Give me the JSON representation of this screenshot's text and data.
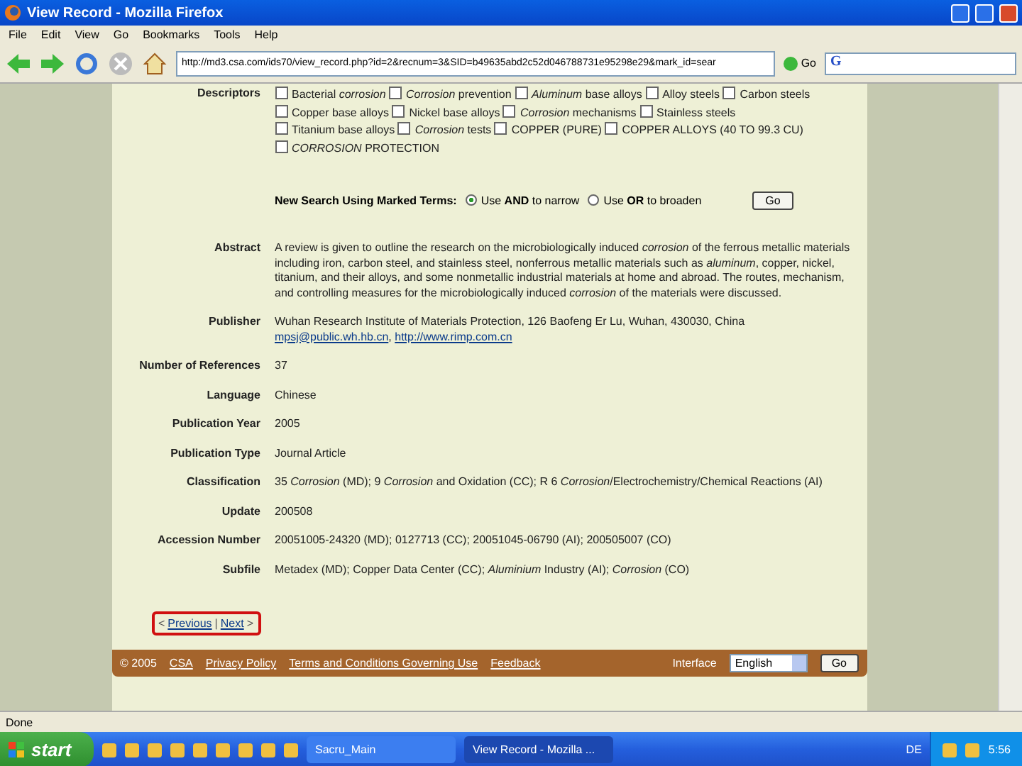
{
  "window": {
    "title": "View Record - Mozilla Firefox"
  },
  "menu": [
    "File",
    "Edit",
    "View",
    "Go",
    "Bookmarks",
    "Tools",
    "Help"
  ],
  "toolbar": {
    "url": "http://md3.csa.com/ids70/view_record.php?id=2&recnum=3&SID=b49635abd2c52d046788731e95298e29&mark_id=sear",
    "go": "Go",
    "search_logo": "G"
  },
  "record": {
    "descriptors": [
      {
        "text": "Bacterial *corrosion*",
        "checked": false
      },
      {
        "text": "*Corrosion* prevention",
        "checked": false
      },
      {
        "text": "*Aluminum* base alloys",
        "checked": false
      },
      {
        "text": "Alloy steels",
        "checked": false
      },
      {
        "text": "Carbon steels",
        "checked": false
      },
      {
        "text": "Copper base alloys",
        "checked": false
      },
      {
        "text": "Nickel base alloys",
        "checked": false
      },
      {
        "text": "*Corrosion* mechanisms",
        "checked": false
      },
      {
        "text": "Stainless steels",
        "checked": false
      },
      {
        "text": "Titanium base alloys",
        "checked": false
      },
      {
        "text": "*Corrosion* tests",
        "checked": false
      },
      {
        "text": "COPPER (PURE)",
        "checked": false
      },
      {
        "text": "COPPER ALLOYS (40 TO 99.3 CU)",
        "checked": false
      },
      {
        "text": "*CORROSION* PROTECTION",
        "checked": false
      }
    ],
    "descriptors_label": "Descriptors",
    "search": {
      "label": "New Search Using Marked Terms:",
      "options": [
        {
          "text": "Use **AND** to narrow",
          "selected": true
        },
        {
          "text": "Use **OR** to broaden",
          "selected": false
        }
      ],
      "button": "Go"
    },
    "fields": [
      {
        "label": "Abstract",
        "value": "A review is given to outline the research on the microbiologically induced *corrosion* of the ferrous metallic materials including iron, carbon steel, and stainless steel, nonferrous metallic materials such as *aluminum*, copper, nickel, titanium, and their alloys, and some nonmetallic industrial materials at home and abroad. The routes, mechanism, and controlling measures for the microbiologically induced *corrosion* of the materials were discussed."
      },
      {
        "label": "Publisher",
        "value": "Wuhan Research Institute of Materials Protection, 126 Baofeng Er Lu, Wuhan, 430030, China",
        "links": [
          "mpsj@public.wh.hb.cn",
          "http://www.rimp.com.cn"
        ],
        "link_separator": ","
      },
      {
        "label": "Number of References",
        "value": "37"
      },
      {
        "label": "Language",
        "value": "Chinese"
      },
      {
        "label": "Publication Year",
        "value": "2005"
      },
      {
        "label": "Publication Type",
        "value": "Journal Article"
      },
      {
        "label": "Classification",
        "value": "35 *Corrosion* (MD); 9 *Corrosion* and Oxidation (CC); R 6 *Corrosion*/Electrochemistry/Chemical Reactions (AI)"
      },
      {
        "label": "Update",
        "value": "200508"
      },
      {
        "label": "Accession Number",
        "value": "20051005-24320 (MD); 0127713 (CC); 20051045-06790 (AI); 200505007 (CO)"
      },
      {
        "label": "Subfile",
        "value": "Metadex (MD); Copper Data Center (CC); *Aluminium* Industry (AI); *Corrosion* (CO)"
      }
    ],
    "nav": {
      "prev_arrow": "<",
      "previous": "Previous",
      "separator": "|",
      "next": "Next",
      "next_arrow": ">"
    }
  },
  "footer": {
    "copyright": "© 2005",
    "links": [
      "CSA",
      "Privacy Policy",
      "Terms and Conditions Governing Use",
      "Feedback"
    ],
    "interface_label": "Interface",
    "language": "English",
    "go": "Go"
  },
  "status_bar": "Done",
  "taskbar": {
    "start": "start",
    "tasks": [
      {
        "label": "Sacru_Main",
        "selected": false
      },
      {
        "label": "View Record - Mozilla ...",
        "selected": true
      }
    ],
    "tray": "DE",
    "clock": "5:56"
  }
}
